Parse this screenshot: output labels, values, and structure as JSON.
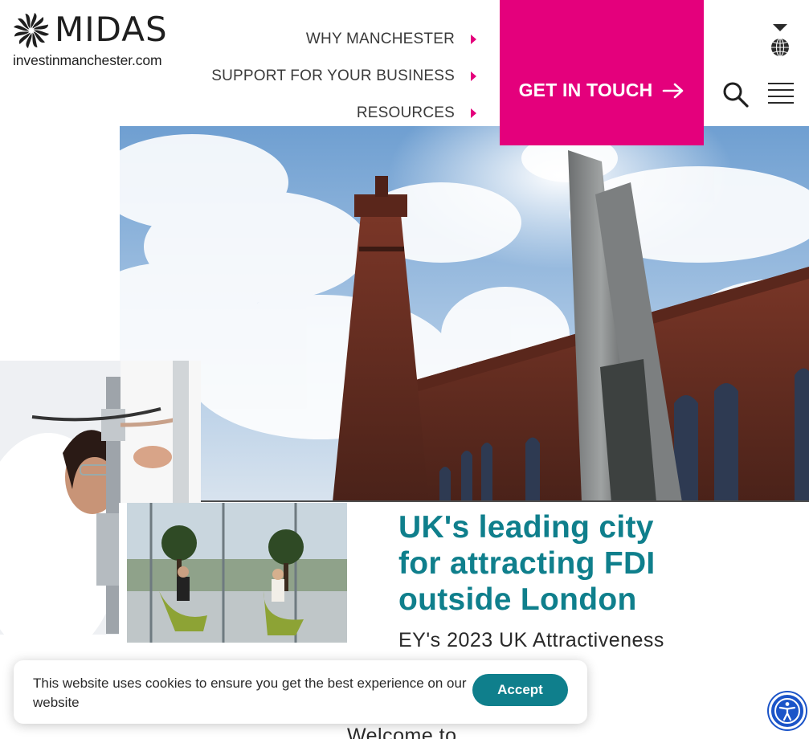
{
  "brand": {
    "name": "MIDAS",
    "tagline": "investinmanchester.com"
  },
  "nav": {
    "items": [
      {
        "label": "WHY MANCHESTER"
      },
      {
        "label": "SUPPORT FOR YOUR BUSINESS"
      },
      {
        "label": "RESOURCES"
      }
    ]
  },
  "cta": {
    "label": "GET IN TOUCH"
  },
  "icons": {
    "language": "globe-icon",
    "search": "search-icon",
    "menu": "hamburger-icon",
    "accessibility": "accessibility-icon"
  },
  "hero": {
    "headline": "UK's leading city for attracting FDI outside London",
    "subheading": "EY's 2023 UK Attractiveness",
    "welcome": "Welcome to"
  },
  "cookie": {
    "message": "This website uses cookies to ensure you get the best experience on our website",
    "accept_label": "Accept"
  },
  "colors": {
    "accent": "#e4007c",
    "teal": "#0f7f8c",
    "accessibility": "#1b54c8"
  }
}
